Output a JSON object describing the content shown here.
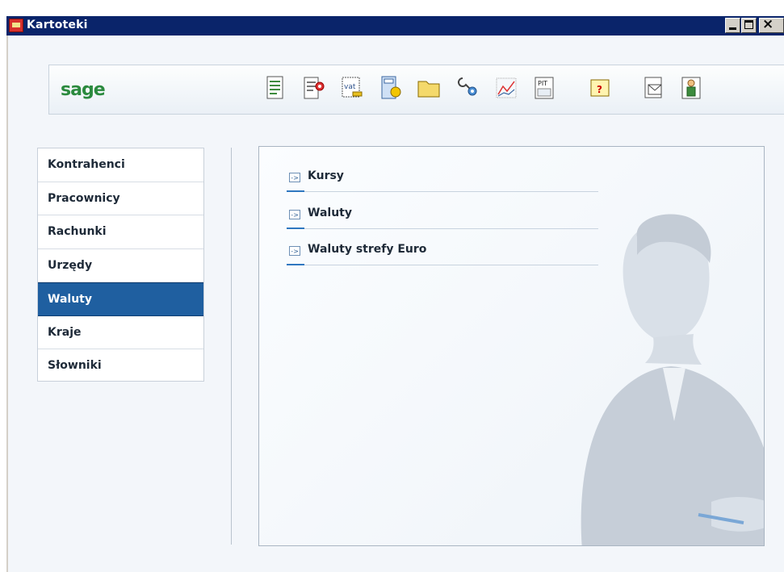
{
  "window": {
    "title": "Kartoteki"
  },
  "toolbar": {
    "logo": "sage",
    "icons": [
      "document-icon",
      "document-settings-icon",
      "vat-invoice-icon",
      "calculator-coin-icon",
      "folder-icon",
      "tools-settings-icon",
      "chart-icon",
      "pit-form-icon",
      "help-icon",
      "mail-icon",
      "person-card-icon"
    ],
    "pit_text": "PIT",
    "vat_text": "vat",
    "help_text": "?"
  },
  "nav": {
    "items": [
      {
        "label": "Kontrahenci",
        "active": false
      },
      {
        "label": "Pracownicy",
        "active": false
      },
      {
        "label": "Rachunki",
        "active": false
      },
      {
        "label": "Urzędy",
        "active": false
      },
      {
        "label": "Waluty",
        "active": true
      },
      {
        "label": "Kraje",
        "active": false
      },
      {
        "label": "Słowniki",
        "active": false
      }
    ]
  },
  "content": {
    "links": [
      {
        "label": "Kursy"
      },
      {
        "label": "Waluty"
      },
      {
        "label": "Waluty strefy Euro"
      }
    ],
    "arrow_glyph": "->"
  },
  "colors": {
    "titlebar": "#0a246a",
    "active_nav": "#1f5fa0",
    "accent": "#2f77c0",
    "logo": "#2b8a3e"
  }
}
